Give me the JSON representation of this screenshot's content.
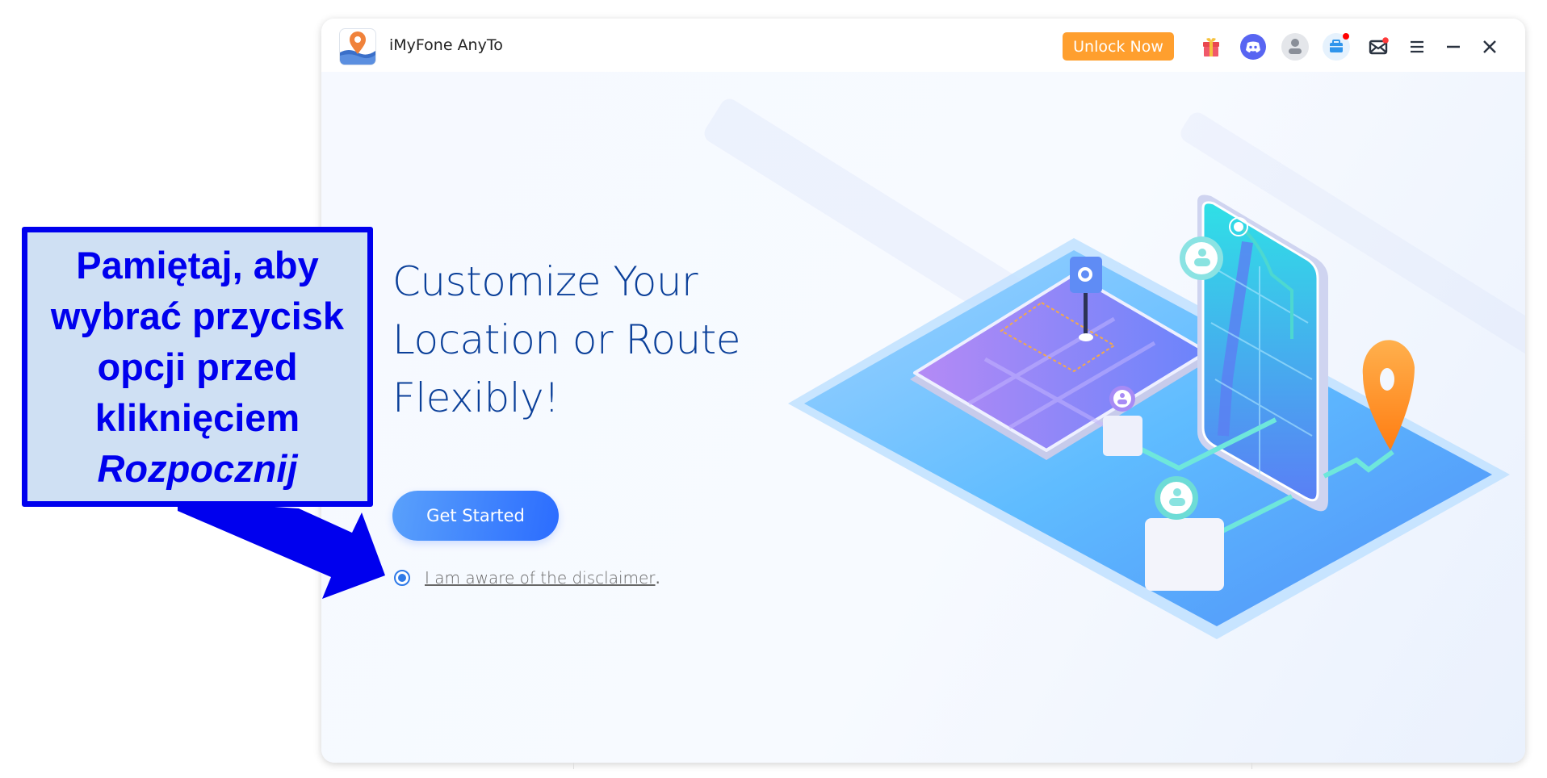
{
  "window": {
    "title": "iMyFone AnyTo",
    "unlock_button": "Unlock Now",
    "header_icons": [
      "gift-icon",
      "discord-icon",
      "account-icon",
      "toolbox-icon",
      "mail-icon",
      "menu-icon",
      "minimize-icon",
      "close-icon"
    ],
    "colors": {
      "accent": "#2b6cff",
      "unlock": "#ff9f2e",
      "heading": "#0a3f99",
      "notification": "#ff0000"
    }
  },
  "main": {
    "heading_lines": [
      "Customize Your",
      "Location or Route",
      "Flexibly!"
    ],
    "get_started_label": "Get Started",
    "disclaimer": {
      "checked": true,
      "link_text": "I am aware of the disclaimer",
      "suffix": "."
    }
  },
  "annotation": {
    "lines": [
      "Pamiętaj, aby",
      "wybrać przycisk",
      "opcji przed",
      "kliknięciem"
    ],
    "emphasis": "Rozpocznij",
    "color": "#0000ee",
    "background": "#cfe0f3"
  }
}
